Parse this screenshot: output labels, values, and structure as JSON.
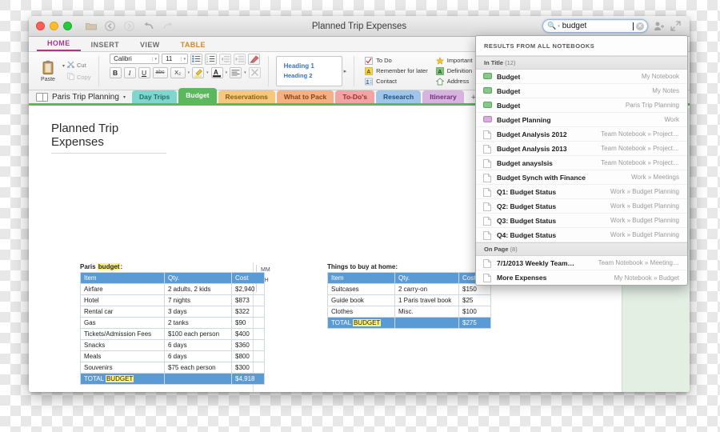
{
  "window": {
    "title": "Planned Trip Expenses"
  },
  "titlebar": {
    "icons": [
      "folder-icon",
      "back-icon",
      "forward-icon",
      "undo-icon",
      "redo-icon"
    ],
    "share_icon": "add-person-icon",
    "expand_icon": "expand-icon"
  },
  "search": {
    "value": "budget",
    "magnifier": "search-icon",
    "caret": "▾",
    "clear": "✕"
  },
  "ribbon_tabs": [
    {
      "label": "HOME",
      "active": true
    },
    {
      "label": "INSERT",
      "active": false
    },
    {
      "label": "VIEW",
      "active": false
    },
    {
      "label": "TABLE",
      "active": false
    }
  ],
  "ribbon": {
    "paste_label": "Paste",
    "cut_label": "Cut",
    "copy_label": "Copy",
    "font_name": "Calibri",
    "font_size": "11",
    "bold": "B",
    "italic": "I",
    "underline": "U",
    "strikethrough": "abc",
    "subscript": "X₂",
    "highlight_icon": "highlighter-icon",
    "fontcolor_icon": "font-color-icon",
    "align_icon": "align-icon",
    "clear_icon": "clear-formatting-icon",
    "bullets_icon": "bulleted-list-icon",
    "numbering_icon": "numbered-list-icon",
    "outdent_icon": "decrease-indent-icon",
    "indent_icon": "increase-indent-icon",
    "eraser_icon": "style-eraser-icon",
    "styles": [
      "Heading 1",
      "Heading 2"
    ],
    "gallery_arrow": "▸",
    "tags": [
      {
        "label": "To Do",
        "icon": "checkbox-icon"
      },
      {
        "label": "Remember for later",
        "icon": "yellow-a-icon"
      },
      {
        "label": "Contact",
        "icon": "contact-icon"
      },
      {
        "label": "Important",
        "icon": "star-icon"
      },
      {
        "label": "Definition",
        "icon": "green-a-icon"
      },
      {
        "label": "Address",
        "icon": "house-icon"
      }
    ]
  },
  "notebook": {
    "name": "Paris Trip Planning",
    "caret": "▾",
    "add_tab": "+",
    "tabs": [
      {
        "label": "Day Trips",
        "color": "#7fd6cf",
        "text": "#1d6f68",
        "active": false
      },
      {
        "label": "Budget",
        "color": "#5cb85c",
        "text": "#ffffff",
        "active": true
      },
      {
        "label": "Reservations",
        "color": "#f5c87f",
        "text": "#8a5b14",
        "active": false
      },
      {
        "label": "What to Pack",
        "color": "#f5b183",
        "text": "#8a4413",
        "active": false
      },
      {
        "label": "To-Do's",
        "color": "#f0a4a4",
        "text": "#9c2b2b",
        "active": false
      },
      {
        "label": "Research",
        "color": "#9fc5e8",
        "text": "#1d4f80",
        "active": false
      },
      {
        "label": "Itinerary",
        "color": "#d9b3e0",
        "text": "#6a2f7a",
        "active": false
      }
    ]
  },
  "page": {
    "title": "Planned Trip Expenses",
    "author_initials": [
      "MM",
      "BH"
    ],
    "tables": [
      {
        "caption_pre": "Paris ",
        "caption_hl": "budget",
        "caption_post": ":",
        "headers": [
          "Item",
          "Qty.",
          "Cost"
        ],
        "rows": [
          [
            "Airfare",
            "2 adults, 2 kids",
            "$2,940"
          ],
          [
            "Hotel",
            "7 nights",
            "$873"
          ],
          [
            "Rental car",
            "3 days",
            "$322"
          ],
          [
            "Gas",
            "2 tanks",
            "$90"
          ],
          [
            "Tickets/Admission Fees",
            "$100 each person",
            "$400"
          ],
          [
            "Snacks",
            "6 days",
            "$360"
          ],
          [
            "Meals",
            "6 days",
            "$800"
          ],
          [
            "Souvenirs",
            "$75 each person",
            "$300"
          ]
        ],
        "total_pre": "TOTAL ",
        "total_hl": "BUDGET",
        "total_qty": "",
        "total_cost": "$4,918"
      },
      {
        "caption_pre": "Things to buy at home:",
        "caption_hl": "",
        "caption_post": "",
        "headers": [
          "Item",
          "Qty.",
          "Cost"
        ],
        "rows": [
          [
            "Suitcases",
            "2 carry-on",
            "$150"
          ],
          [
            "Guide book",
            "1 Paris travel book",
            "$25"
          ],
          [
            "Clothes",
            "Misc.",
            "$100"
          ]
        ],
        "total_pre": "TOTAL ",
        "total_hl": "BUDGET",
        "total_qty": "",
        "total_cost": "$275"
      }
    ]
  },
  "dropdown": {
    "header": "RESULTS FROM ALL NOTEBOOKS",
    "sections": [
      {
        "label": "In Title",
        "count": "(12)",
        "items": [
          {
            "label": "Budget",
            "path": "My Notebook",
            "icon": "section-tab-icon",
            "color": "#86c98a"
          },
          {
            "label": "Budget",
            "path": "My Notes",
            "icon": "section-tab-icon",
            "color": "#86c98a"
          },
          {
            "label": "Budget",
            "path": "Paris Trip Planning",
            "icon": "section-tab-icon",
            "color": "#86c98a"
          },
          {
            "label": "Budget Planning",
            "path": "Work",
            "icon": "section-tab-icon",
            "color": "#d9aede"
          },
          {
            "label": "Budget Analysis 2012",
            "path": "Team Notebook » Project…",
            "icon": "page-icon",
            "color": ""
          },
          {
            "label": "Budget Analysis 2013",
            "path": "Team Notebook » Project…",
            "icon": "page-icon",
            "color": ""
          },
          {
            "label": "Budget anaysIsis",
            "path": "Team Notebook » Project…",
            "icon": "page-icon",
            "color": ""
          },
          {
            "label": "Budget Synch with Finance",
            "path": "Work » Meetings",
            "icon": "page-icon",
            "color": ""
          },
          {
            "label": "Q1: Budget Status",
            "path": "Work » Budget Planning",
            "icon": "page-icon",
            "color": ""
          },
          {
            "label": "Q2: Budget Status",
            "path": "Work » Budget Planning",
            "icon": "page-icon",
            "color": ""
          },
          {
            "label": "Q3: Budget Status",
            "path": "Work » Budget Planning",
            "icon": "page-icon",
            "color": ""
          },
          {
            "label": "Q4: Budget Status",
            "path": "Work » Budget Planning",
            "icon": "page-icon",
            "color": ""
          }
        ]
      },
      {
        "label": "On Page",
        "count": "(8)",
        "items": [
          {
            "label": "7/1/2013  Weekly Team…",
            "path": "Team Notebook » Meeting…",
            "icon": "page-icon",
            "color": ""
          },
          {
            "label": "More Expenses",
            "path": "My Notebook » Budget",
            "icon": "page-icon",
            "color": ""
          }
        ]
      }
    ]
  }
}
